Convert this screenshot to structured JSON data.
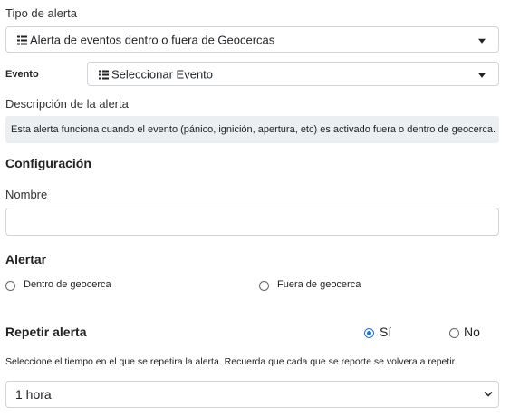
{
  "tipo": {
    "label": "Tipo de alerta",
    "value": "Alerta de eventos dentro o fuera de Geocercas",
    "icon": "list-icon"
  },
  "evento": {
    "label": "Evento",
    "value": "Seleccionar Evento",
    "icon": "list-icon"
  },
  "descripcion": {
    "label": "Descripción de la alerta",
    "text": "Esta alerta funciona cuando el evento (pánico, ignición, apertura, etc) es activado fuera o dentro de geocerca."
  },
  "configuracion": {
    "heading": "Configuración",
    "nombre_label": "Nombre",
    "nombre_value": ""
  },
  "alertar": {
    "heading": "Alertar",
    "option_dentro": "Dentro de geocerca",
    "option_fuera": "Fuera de geocerca"
  },
  "repetir": {
    "heading": "Repetir alerta",
    "option_si": "Sí",
    "option_no": "No",
    "selected": "Sí",
    "help": "Seleccione el tiempo en el que se repetira la alerta. Recuerda que cada que se reporte se volvera a repetir.",
    "interval_value": "1 hora"
  },
  "colors": {
    "border": "#ced4da",
    "description_bg": "#eceff1",
    "radio_checked": "#1a73e8"
  }
}
